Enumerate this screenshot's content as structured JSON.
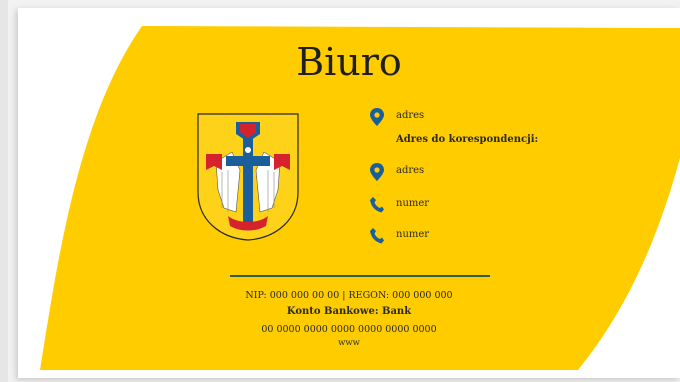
{
  "title": "Biuro",
  "colors": {
    "accent_yellow": "#ffcc00",
    "icon_blue": "#1a5f9c",
    "divider_green": "#2f5c46"
  },
  "contact": {
    "address_1": "adres",
    "icon_address_1": "location-pin-icon",
    "correspondence_heading": "Adres do korespondencji:",
    "address_2": "adres",
    "icon_address_2": "location-pin-icon",
    "phone_1": "numer",
    "icon_phone_1": "phone-icon",
    "phone_2": "numer",
    "icon_phone_2": "phone-icon"
  },
  "emblem": "coat-of-arms-icon",
  "footer": {
    "ids": "NIP: 000 000 00 00 | REGON: 000 000 000",
    "bank_label": "Konto Bankowe: Bank",
    "account": "00 0000 0000 0000 0000 0000 0000",
    "www": "www"
  }
}
